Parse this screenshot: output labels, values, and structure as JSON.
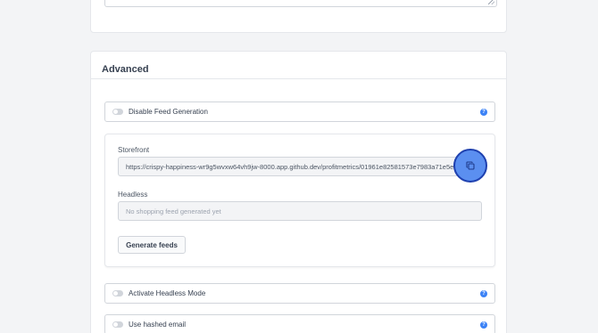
{
  "advanced": {
    "title": "Advanced",
    "disable_feed": {
      "label": "Disable Feed Generation",
      "help": "?",
      "enabled": false
    },
    "storefront": {
      "label": "Storefront",
      "value": "https://crispy-happiness-wr9g5wvxw64vh9jw-8000.app.github.dev/profitmetrics/01961e82581573e7983a71e5e61"
    },
    "headless": {
      "label": "Headless",
      "placeholder": "No shopping feed generated yet"
    },
    "generate_button": "Generate feeds",
    "headless_mode": {
      "label": "Activate Headless Mode",
      "help": "?",
      "enabled": false
    },
    "hashed_email": {
      "label": "Use hashed email",
      "help": "?",
      "enabled": false
    }
  },
  "colors": {
    "accent": "#3b82f6",
    "highlight": "#1e40af"
  }
}
